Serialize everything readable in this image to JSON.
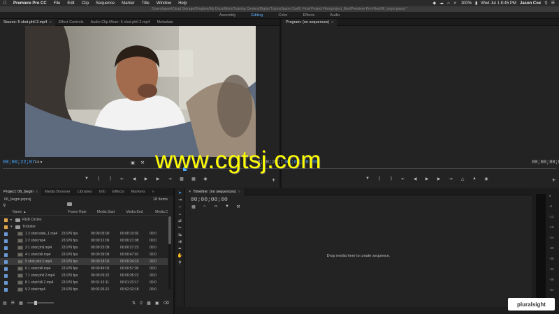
{
  "menubar": {
    "apple": "",
    "app": "Premiere Pro CC",
    "items": [
      "File",
      "Edit",
      "Clip",
      "Sequence",
      "Marker",
      "Title",
      "Window",
      "Help"
    ],
    "battery": "100%",
    "clock": "Wed Jul 1  8:45 PM",
    "user": "Jason Cox"
  },
  "titlebar": "/Users/jason/Cloud Storage/Dropbox/My Docs/Work/Training Centers/Digital Tutors/Jason Cox/6. Final Project Files/project_files/Premiere Pro Files/06_begin.prproj *",
  "workspaces": [
    "Assembly",
    "Editing",
    "Color",
    "Effects",
    "Audio"
  ],
  "workspace_active": "Editing",
  "source": {
    "tabs": [
      "Source: 5 shot phil 2.mp4",
      "Effect Controls",
      "Audio Clip Mixer: 5 shot phil 2.mp4",
      "Metadata"
    ],
    "timecode": "00;00;22;07",
    "fit": "Fit",
    "end_timecode": "00;00;24;10"
  },
  "program": {
    "tab": "Program: (no sequences)",
    "timecode_left": "00;00;00;00",
    "timecode_right": "00;00;00;00"
  },
  "project": {
    "tabs": [
      "Project: 06_begin",
      "Media Browser",
      "Libraries",
      "Info",
      "Effects",
      "Markers"
    ],
    "file": "06_begin.prproj",
    "count": "18 Items",
    "headers": [
      "Name",
      "Frame Rate",
      "Media Start",
      "Media End",
      "Media Dur"
    ],
    "rows": [
      {
        "type": "folder",
        "color": "#e0a64a",
        "name": "RGB Circles",
        "fps": "",
        "start": "",
        "end": "",
        "dur": ""
      },
      {
        "type": "folder-open",
        "color": "#e0a64a",
        "name": "Trickster",
        "fps": "",
        "start": "",
        "end": "",
        "dur": ""
      },
      {
        "type": "clip",
        "color": "#6b9ad6",
        "name": "1 2 shot wide_1.mp4",
        "fps": "23.976 fps",
        "start": "00:00:03:00",
        "end": "00:00:10:02",
        "dur": "00:0"
      },
      {
        "type": "clip",
        "color": "#6b9ad6",
        "name": "2 2 shot.mp4",
        "fps": "23.976 fps",
        "start": "00:00:12:06",
        "end": "00:00:21:08",
        "dur": "00:0"
      },
      {
        "type": "clip",
        "color": "#6b9ad6",
        "name": "3 1 shot phil.mp4",
        "fps": "23.976 fps",
        "start": "00:00:23:09",
        "end": "00:00:27:23",
        "dur": "00:0"
      },
      {
        "type": "clip",
        "color": "#6b9ad6",
        "name": "4 1 shot bill.mp4",
        "fps": "23.976 fps",
        "start": "00:00:39:09",
        "end": "00:00:47:01",
        "dur": "00:0"
      },
      {
        "type": "clip",
        "color": "#6b9ad6",
        "name": "5 shot phil 2.mp4",
        "fps": "23.976 fps",
        "start": "00:00:18:03",
        "end": "00:00:24:10",
        "dur": "00:0",
        "selected": true
      },
      {
        "type": "clip",
        "color": "#6b9ad6",
        "name": "6 1 shot bill.mp4",
        "fps": "23.976 fps",
        "start": "00:00:49:03",
        "end": "00:00:57:00",
        "dur": "00:0"
      },
      {
        "type": "clip",
        "color": "#6b9ad6",
        "name": "7 1 shot phil 2.mp4",
        "fps": "23.976 fps",
        "start": "00:00:29:22",
        "end": "00:00:35:22",
        "dur": "00:0"
      },
      {
        "type": "clip",
        "color": "#6b9ad6",
        "name": "8 1 shot bill 2.mp4",
        "fps": "23.976 fps",
        "start": "00:01:13:11",
        "end": "00:01:23:17",
        "dur": "00:0"
      },
      {
        "type": "clip",
        "color": "#6b9ad6",
        "name": "9 2 shot.mp4",
        "fps": "23.976 fps",
        "start": "00:02:26:21",
        "end": "00:02:32:18",
        "dur": "00:0"
      }
    ]
  },
  "timeline": {
    "tab": "Timeline: (no sequences)",
    "timecode": "00;00;00;00",
    "drop_hint": "Drop media here to create sequence."
  },
  "meters": {
    "scale": [
      "0",
      "-6",
      "-12",
      "-18",
      "-24",
      "-30",
      "-36",
      "-42",
      "-48",
      "-54"
    ]
  },
  "watermark": "www.cgtsj.com",
  "pluralsight": "pluralsight"
}
